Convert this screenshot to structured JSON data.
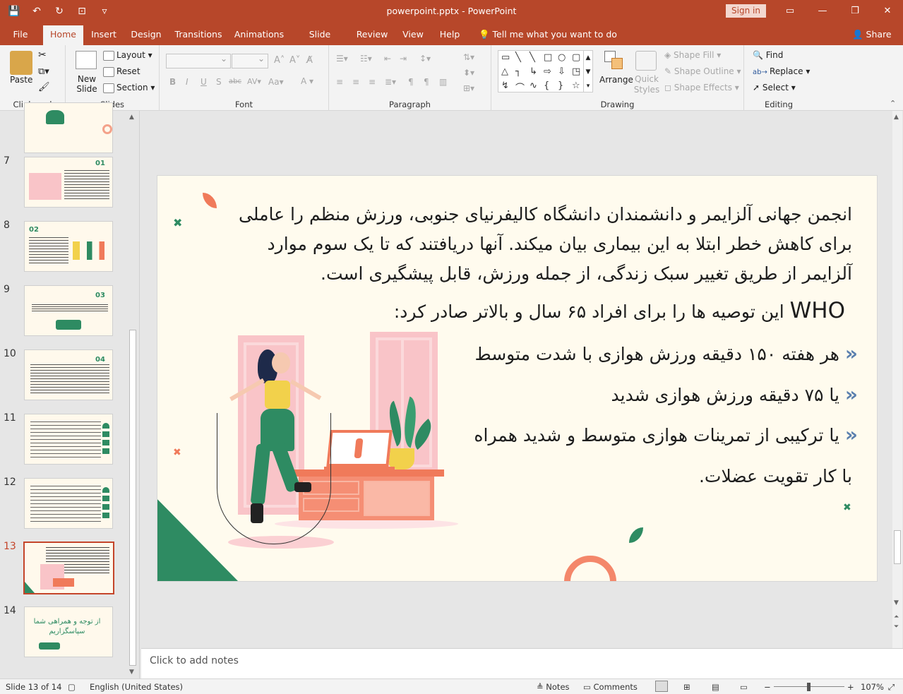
{
  "window": {
    "title": "powerpoint.pptx  -  PowerPoint",
    "sign_in": "Sign in"
  },
  "tabs": [
    "File",
    "Home",
    "Insert",
    "Design",
    "Transitions",
    "Animations",
    "Slide Show",
    "Review",
    "View",
    "Help"
  ],
  "active_tab": "Home",
  "tell_me": "Tell me what you want to do",
  "share": "Share",
  "ribbon": {
    "clipboard": {
      "label": "Clipboard",
      "paste": "Paste"
    },
    "slides": {
      "label": "Slides",
      "new_slide": "New Slide",
      "layout": "Layout",
      "reset": "Reset",
      "section": "Section"
    },
    "font": {
      "label": "Font"
    },
    "paragraph": {
      "label": "Paragraph"
    },
    "drawing": {
      "label": "Drawing",
      "arrange": "Arrange",
      "quick_styles": "Quick Styles",
      "shape_fill": "Shape Fill",
      "shape_outline": "Shape Outline",
      "shape_effects": "Shape Effects"
    },
    "editing": {
      "label": "Editing",
      "find": "Find",
      "replace": "Replace",
      "select": "Select"
    }
  },
  "thumbnails": [
    {
      "num": "7",
      "badge": "01"
    },
    {
      "num": "8",
      "badge": "02"
    },
    {
      "num": "9",
      "badge": "03"
    },
    {
      "num": "10",
      "badge": "04"
    },
    {
      "num": "11",
      "badge": ""
    },
    {
      "num": "12",
      "badge": ""
    },
    {
      "num": "13",
      "badge": ""
    },
    {
      "num": "14",
      "badge": "",
      "text": "از توجه و همراهی شما سپاسگزاریم"
    }
  ],
  "selected_slide": "13",
  "slide": {
    "paragraph1": "انجمن جهانی آلزایمر و دانشمندان دانشگاه کالیفرنیای جنوبی، ورزش منظم را عاملی برای کاهش خطر ابتلا به این بیماری بیان میکند. آنها دریافتند که تا یک سوم موارد آلزایمر از طریق تغییر سبک زندگی، از جمله ورزش، قابل پیشگیری است.",
    "who": "WHO",
    "paragraph2": "این توصیه ها را برای افراد ۶۵ سال و بالاتر صادر کرد:",
    "bullets": [
      "هر هفته ۱۵۰ دقیقه ورزش هوازی با شدت متوسط",
      "یا ۷۵ دقیقه ورزش هوازی شدید",
      "یا ترکیبی از تمرینات هوازی متوسط و شدید همراه"
    ],
    "last_line": "با کار تقویت عضلات.",
    "colors": {
      "green": "#2e8b62",
      "coral": "#f07a5a",
      "pink": "#f9c4c8",
      "yellow": "#f2d14b"
    }
  },
  "notes_placeholder": "Click to add notes",
  "status": {
    "slide_info": "Slide 13 of 14",
    "language": "English (United States)",
    "notes": "Notes",
    "comments": "Comments",
    "zoom": "107%"
  }
}
